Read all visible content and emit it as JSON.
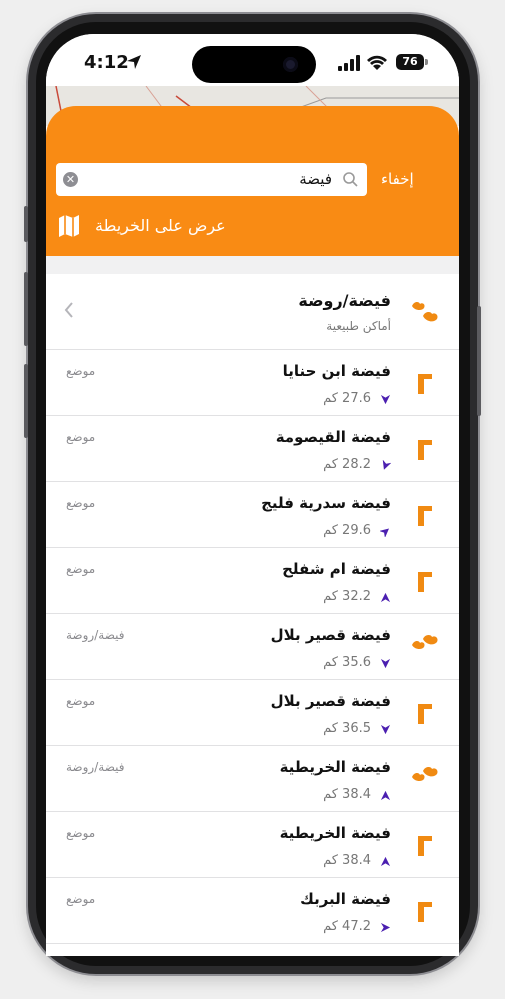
{
  "status_bar": {
    "time": "4:12",
    "battery": "76"
  },
  "search": {
    "value": "فيضة",
    "hide_label": "إخفاء"
  },
  "map_button": {
    "label": "عرض على الخريطة"
  },
  "category": {
    "title": "فيضة/روضة",
    "subtitle": "أماكن طبيعية"
  },
  "results": [
    {
      "name": "فيضة ابن حنايا",
      "distance": "27.6 كم",
      "type": "موضع",
      "icon": "place-icon",
      "bearing": 180
    },
    {
      "name": "فيضة القيصومة",
      "distance": "28.2 كم",
      "type": "موضع",
      "icon": "place-icon",
      "bearing": 200
    },
    {
      "name": "فيضة سدرية فليج",
      "distance": "29.6 كم",
      "type": "موضع",
      "icon": "place-icon",
      "bearing": 50
    },
    {
      "name": "فيضة ام شفلح",
      "distance": "32.2 كم",
      "type": "موضع",
      "icon": "place-icon",
      "bearing": 0
    },
    {
      "name": "فيضة قصير بلال",
      "distance": "35.6 كم",
      "type": "فيضة/روضة",
      "icon": "nature-icon",
      "bearing": 180
    },
    {
      "name": "فيضة قصير بلال",
      "distance": "36.5 كم",
      "type": "موضع",
      "icon": "place-icon",
      "bearing": 180
    },
    {
      "name": "فيضة الخريطية",
      "distance": "38.4 كم",
      "type": "فيضة/روضة",
      "icon": "nature-icon",
      "bearing": 0
    },
    {
      "name": "فيضة الخريطية",
      "distance": "38.4 كم",
      "type": "موضع",
      "icon": "place-icon",
      "bearing": 0
    },
    {
      "name": "فيضة البربك",
      "distance": "47.2 كم",
      "type": "موضع",
      "icon": "place-icon",
      "bearing": 90
    }
  ],
  "colors": {
    "accent": "#f98b14",
    "arrow": "#4b1fb0",
    "icon": "#f08a12"
  }
}
